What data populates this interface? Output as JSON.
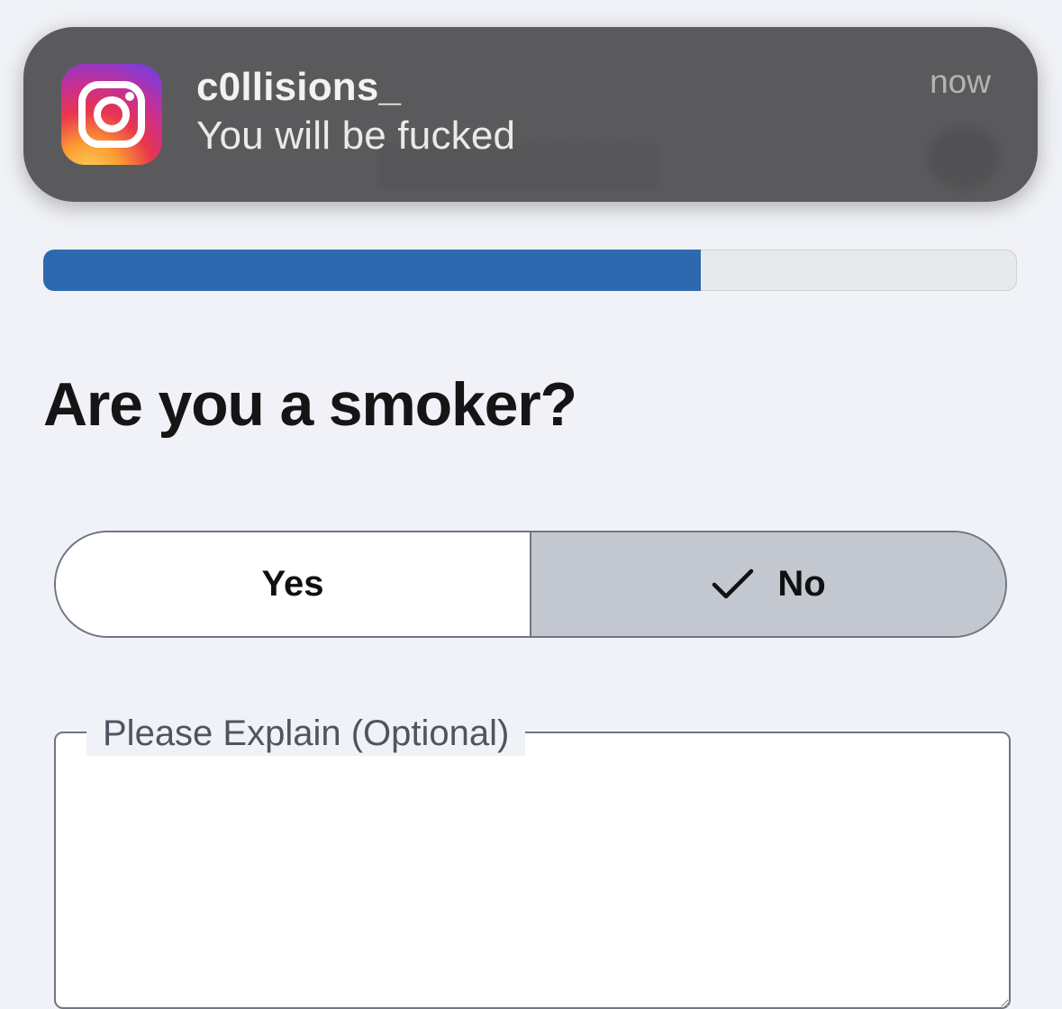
{
  "notification": {
    "app_icon": "instagram-icon",
    "sender": "c0llisions_",
    "message": "You will be fucked",
    "time": "now"
  },
  "progress": {
    "fraction": 0.675,
    "fill_color": "#2e69b0"
  },
  "question": {
    "text": "Are you a smoker?"
  },
  "options": {
    "yes_label": "Yes",
    "no_label": "No",
    "selected": "No",
    "check_icon": "checkmark-icon"
  },
  "explain": {
    "label": "Please Explain (Optional)",
    "value": ""
  },
  "colors": {
    "accent": "#2e69b0",
    "selected_option_bg": "#c3c7d0",
    "page_bg": "#f0f2f7"
  }
}
